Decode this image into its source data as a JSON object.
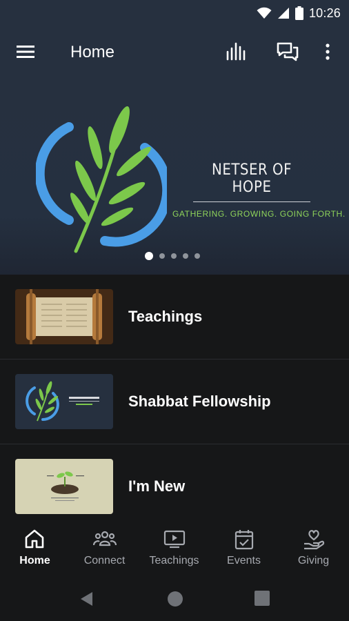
{
  "status_bar": {
    "time": "10:26",
    "icons": [
      "wifi-icon",
      "signal-icon",
      "battery-icon"
    ]
  },
  "app_bar": {
    "title": "Home",
    "icons": [
      "hamburger-menu-icon",
      "podcast-bars-icon",
      "chat-bubbles-icon",
      "overflow-menu-icon"
    ]
  },
  "hero": {
    "brand_name": "NETSER OF HOPE",
    "tagline": "GATHERING. GROWING. GOING FORTH.",
    "slide_count": 5,
    "active_slide": 1
  },
  "list": [
    {
      "label": "Teachings",
      "thumb": "scroll"
    },
    {
      "label": "Shabbat Fellowship",
      "thumb": "logo"
    },
    {
      "label": "I'm New",
      "thumb": "seedling"
    }
  ],
  "bottom_nav": [
    {
      "label": "Home",
      "icon": "home-icon",
      "active": true
    },
    {
      "label": "Connect",
      "icon": "people-icon",
      "active": false
    },
    {
      "label": "Teachings",
      "icon": "video-play-icon",
      "active": false
    },
    {
      "label": "Events",
      "icon": "calendar-check-icon",
      "active": false
    },
    {
      "label": "Giving",
      "icon": "heart-hand-icon",
      "active": false
    }
  ],
  "colors": {
    "header_bg": "#26303f",
    "body_bg": "#161718",
    "logo_blue": "#4a9de6",
    "logo_green": "#7cc84b"
  }
}
